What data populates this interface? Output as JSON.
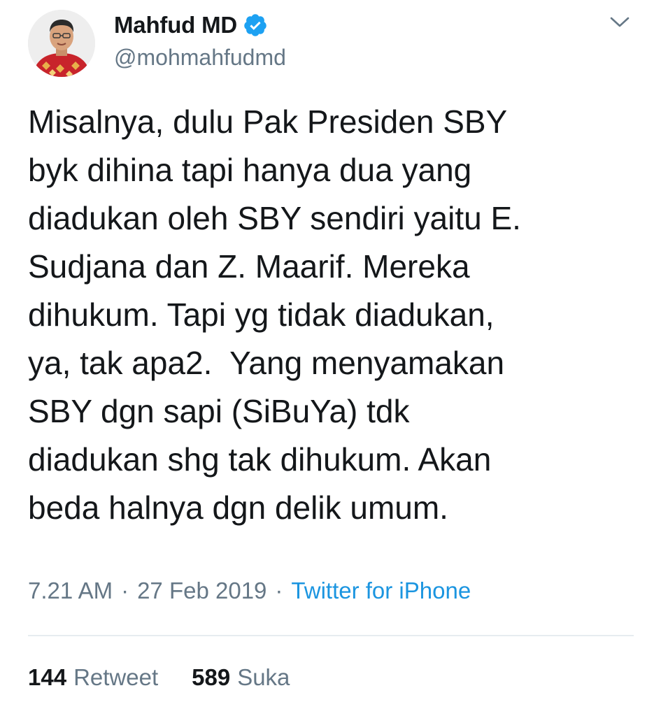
{
  "author": {
    "display_name": "Mahfud MD",
    "handle": "@mohmahfudmd",
    "verified": true,
    "avatar": "profile-photo"
  },
  "menu": {
    "icon": "chevron-down-icon"
  },
  "tweet": {
    "text": "Misalnya, dulu Pak Presiden SBY\nbyk dihina tapi hanya dua yang\ndiadukan oleh SBY sendiri yaitu E.\nSudjana dan Z. Maarif. Mereka\ndihukum. Tapi yg tidak diadukan,\nya, tak apa2.  Yang menyamakan\nSBY dgn sapi (SiBuYa) tdk\ndiadukan shg tak dihukum. Akan\nbeda halnya dgn delik umum."
  },
  "meta": {
    "time": "7.21 AM",
    "separator": "·",
    "date": "27 Feb 2019",
    "source": "Twitter for iPhone"
  },
  "stats": {
    "retweets_count": "144",
    "retweets_label": "Retweet",
    "likes_count": "589",
    "likes_label": "Suka"
  },
  "colors": {
    "text": "#14171a",
    "secondary": "#657786",
    "accent": "#1b95e0",
    "verified": "#1da1f2",
    "divider": "#e6ecf0"
  }
}
